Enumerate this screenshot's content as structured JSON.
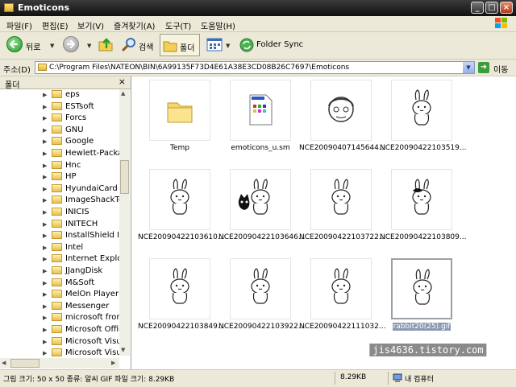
{
  "window": {
    "title": "Emoticons"
  },
  "menu": [
    "파일(F)",
    "편집(E)",
    "보기(V)",
    "즐겨찾기(A)",
    "도구(T)",
    "도움말(H)"
  ],
  "toolbar": {
    "back_label": "뒤로",
    "search_label": "검색",
    "folders_label": "폴더",
    "folder_sync_label": "Folder Sync"
  },
  "address": {
    "label": "주소(D)",
    "path": "C:\\Program Files\\NATEON\\BIN\\6A99135F73D4E61A38E3CD08B26C7697\\Emoticons",
    "go_label": "이동"
  },
  "folder_pane": {
    "title": "폴더",
    "items": [
      "eps",
      "ESTsoft",
      "Forcs",
      "GNU",
      "Google",
      "Hewlett-Packard",
      "Hnc",
      "HP",
      "HyundaiCard Web",
      "ImageShackToolbar",
      "INICIS",
      "INITECH",
      "InstallShield Installation",
      "Intel",
      "Internet Explorer",
      "JJangDisk",
      "M&Soft",
      "MelOn Player",
      "Messenger",
      "microsoft frontpage",
      "Microsoft Office",
      "Microsoft Visual",
      "Microsoft Visual"
    ]
  },
  "files": [
    {
      "name": "Temp",
      "kind": "folder"
    },
    {
      "name": "emoticons_u.sm",
      "kind": "document"
    },
    {
      "name": "NCE20090407145644...",
      "kind": "face"
    },
    {
      "name": "NCE20090422103519...",
      "kind": "rabbit"
    },
    {
      "name": "NCE20090422103610...",
      "kind": "rabbit"
    },
    {
      "name": "NCE20090422103646...",
      "kind": "cat-rabbit"
    },
    {
      "name": "NCE20090422103722...",
      "kind": "rabbit"
    },
    {
      "name": "NCE20090422103809...",
      "kind": "rabbit-dark"
    },
    {
      "name": "NCE20090422103849...",
      "kind": "rabbit"
    },
    {
      "name": "NCE20090422103922...",
      "kind": "rabbit"
    },
    {
      "name": "NCE20090422111032...",
      "kind": "rabbit"
    },
    {
      "name": "rabbit20(25).gif",
      "kind": "rabbit",
      "selected": true
    }
  ],
  "status": {
    "info": "그림 크기: 50 x 50 종류: 알씨 GIF 파일 크기: 8.29KB",
    "size": "8.29KB",
    "zone": "내 컴퓨터"
  },
  "watermark": "jis4636.tistory.com"
}
